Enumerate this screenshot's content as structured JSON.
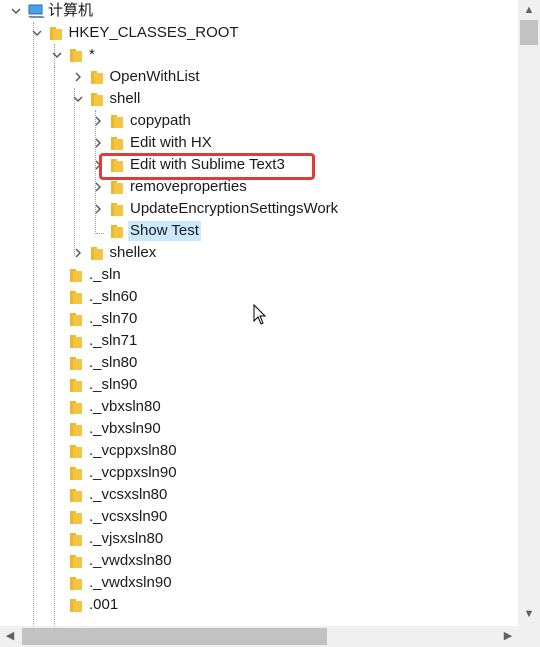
{
  "colors": {
    "selection": "#cce8ff",
    "highlight_box": "#e03a3a",
    "folder_yellow": "#f5c542"
  },
  "tree": {
    "root": {
      "label": "计算机",
      "icon": "computer-icon",
      "expanded": true
    },
    "hive": {
      "label": "HKEY_CLASSES_ROOT",
      "expanded": true
    },
    "star": {
      "label": "*",
      "expanded": true
    },
    "openwithlist": {
      "label": "OpenWithList",
      "expanded": false
    },
    "shell": {
      "label": "shell",
      "expanded": true
    },
    "shell_items": [
      {
        "label": "copypath",
        "has_children": true
      },
      {
        "label": "Edit with HX",
        "has_children": true
      },
      {
        "label": "Edit with Sublime Text3",
        "has_children": true,
        "highlighted": true
      },
      {
        "label": "removeproperties",
        "has_children": true
      },
      {
        "label": "UpdateEncryptionSettingsWork",
        "has_children": true
      },
      {
        "label": "Show Test",
        "has_children": false,
        "selected": true
      }
    ],
    "shellex": {
      "label": "shellex",
      "expanded": false
    },
    "top_keys": [
      "._sln",
      "._sln60",
      "._sln70",
      "._sln71",
      "._sln80",
      "._sln90",
      "._vbxsln80",
      "._vbxsln90",
      "._vcppxsln80",
      "._vcppxsln90",
      "._vcsxsln80",
      "._vcsxsln90",
      "._vjsxsln80",
      "._vwdxsln80",
      "._vwdxsln90",
      ".001"
    ]
  },
  "scrollbars": {
    "up_arrow": "▲",
    "down_arrow": "▼",
    "left_arrow": "◀",
    "right_arrow": "▶"
  }
}
